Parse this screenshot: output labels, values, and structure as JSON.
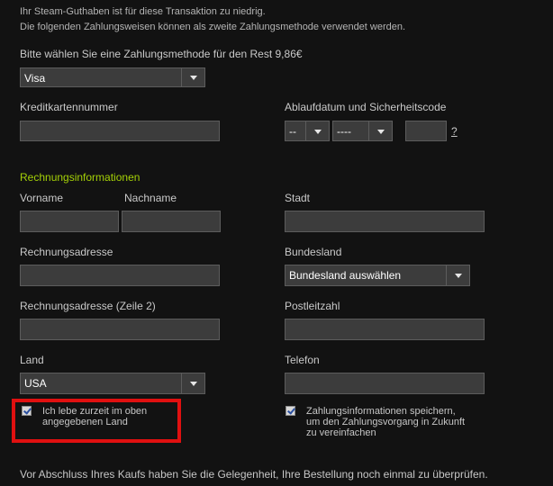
{
  "notice": {
    "line1": "Ihr Steam-Guthaben ist für diese Transaktion zu niedrig.",
    "line2": "Die folgenden Zahlungsweisen können als zweite Zahlungsmethode verwendet werden."
  },
  "payment": {
    "prompt": "Bitte wählen Sie eine Zahlungsmethode für den Rest 9,86€",
    "method_value": "Visa"
  },
  "card": {
    "number_label": "Kreditkartennummer",
    "expiry_label": "Ablaufdatum und Sicherheitscode",
    "month_value": "--",
    "year_value": "----",
    "help_link": "?"
  },
  "billing": {
    "section_title": "Rechnungsinformationen",
    "firstname_label": "Vorname",
    "lastname_label": "Nachname",
    "city_label": "Stadt",
    "address_label": "Rechnungsadresse",
    "state_label": "Bundesland",
    "state_value": "Bundesland auswählen",
    "address2_label": "Rechnungsadresse (Zeile 2)",
    "zip_label": "Postleitzahl",
    "country_label": "Land",
    "country_value": "USA",
    "phone_label": "Telefon"
  },
  "checkboxes": {
    "live_line1": "Ich lebe zurzeit im oben",
    "live_line2": "angegebenen Land",
    "save_line1": "Zahlungsinformationen speichern,",
    "save_line2": "um den Zahlungsvorgang in Zukunft",
    "save_line3": "zu vereinfachen"
  },
  "footer": {
    "text": "Vor Abschluss Ihres Kaufs haben Sie die Gelegenheit, Ihre Bestellung noch einmal zu überprüfen."
  },
  "colors": {
    "background": "#121212",
    "section_green": "#a4d007",
    "input_bg": "#3c3c3c",
    "highlight_red": "#e01010"
  }
}
